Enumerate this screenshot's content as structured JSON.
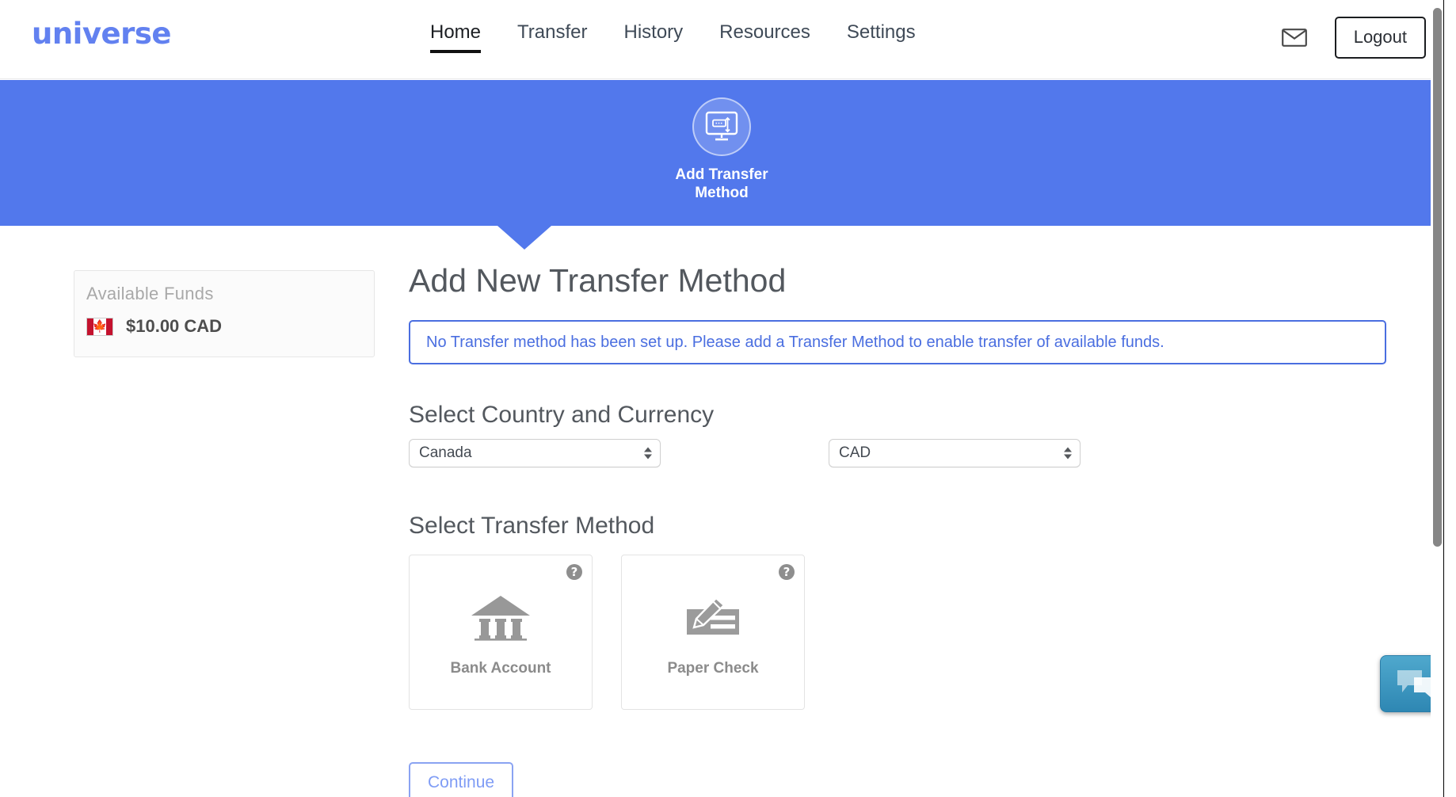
{
  "brand": {
    "name": "universe"
  },
  "nav": {
    "items": [
      {
        "label": "Home",
        "active": true
      },
      {
        "label": "Transfer",
        "active": false
      },
      {
        "label": "History",
        "active": false
      },
      {
        "label": "Resources",
        "active": false
      },
      {
        "label": "Settings",
        "active": false
      }
    ],
    "mail_icon": "mail-envelope-icon",
    "logout_label": "Logout"
  },
  "banner": {
    "step_icon": "monitor-transfer-icon",
    "step_label": "Add Transfer Method",
    "background_color": "#5278ec"
  },
  "sidebar": {
    "available_funds_title": "Available Funds",
    "amount": "$10.00 CAD",
    "flag_icon": "canada-flag-icon"
  },
  "main": {
    "page_title": "Add New Transfer Method",
    "alert_text": "No Transfer method has been set up. Please add a Transfer Method to enable transfer of available funds.",
    "alert_color": "#4a6ee0",
    "country_section_title": "Select Country and Currency",
    "country_value": "Canada",
    "currency_value": "CAD",
    "method_section_title": "Select Transfer Method",
    "methods": [
      {
        "label": "Bank Account",
        "icon": "bank-building-icon",
        "help_icon": "help-question-icon"
      },
      {
        "label": "Paper Check",
        "icon": "paper-check-pen-icon",
        "help_icon": "help-question-icon"
      }
    ],
    "continue_label": "Continue"
  },
  "chat": {
    "icon": "chat-bubbles-icon"
  },
  "colors": {
    "brand_blue": "#6281f0",
    "banner_blue": "#5278ec",
    "alert_blue": "#4a6ee0",
    "continue_blue": "#7f9cf5",
    "flag_red": "#c4122e",
    "chat_blue": "#2e87b3"
  }
}
